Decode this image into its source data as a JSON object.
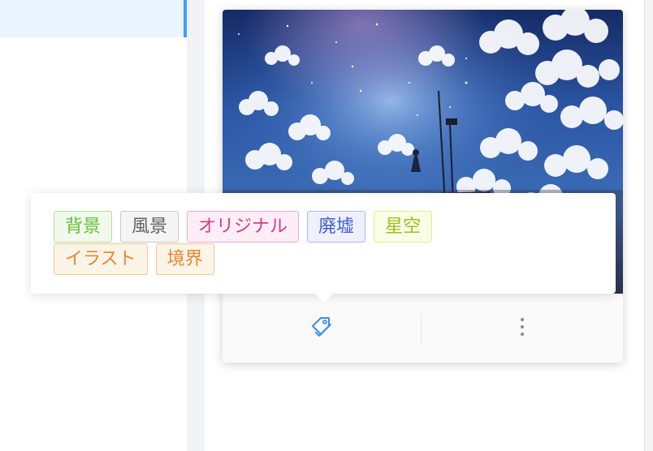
{
  "card": {
    "image": {
      "subject": "starry sky with clouds and a figure standing on a rooftop near a pole"
    },
    "footer": {
      "tag_icon": "tag-icon",
      "more_icon": "more-vertical-icon"
    }
  },
  "popover": {
    "tags": [
      {
        "label": "背景",
        "color": "#67c23a",
        "border": "#b3e19d",
        "bg": "#f0f9eb"
      },
      {
        "label": "風景",
        "color": "#606266",
        "border": "#c8c9cc",
        "bg": "#f4f4f5"
      },
      {
        "label": "オリジナル",
        "color": "#d63c8e",
        "border": "#f2a9d0",
        "bg": "#fdeef6"
      },
      {
        "label": "廃墟",
        "color": "#3f5fd6",
        "border": "#a9b9f0",
        "bg": "#eef1fd"
      },
      {
        "label": "星空",
        "color": "#9fbd1e",
        "border": "#dcef8f",
        "bg": "#f8fde6"
      },
      {
        "label": "イラスト",
        "color": "#e6872c",
        "border": "#f5c58f",
        "bg": "#fdf4e8"
      },
      {
        "label": "境界",
        "color": "#e6872c",
        "border": "#f5c58f",
        "bg": "#fdf4e8"
      }
    ]
  },
  "colors": {
    "accent": "#409eff",
    "icon_blue": "#3a8ee6",
    "icon_gray": "#8a8a8a"
  }
}
